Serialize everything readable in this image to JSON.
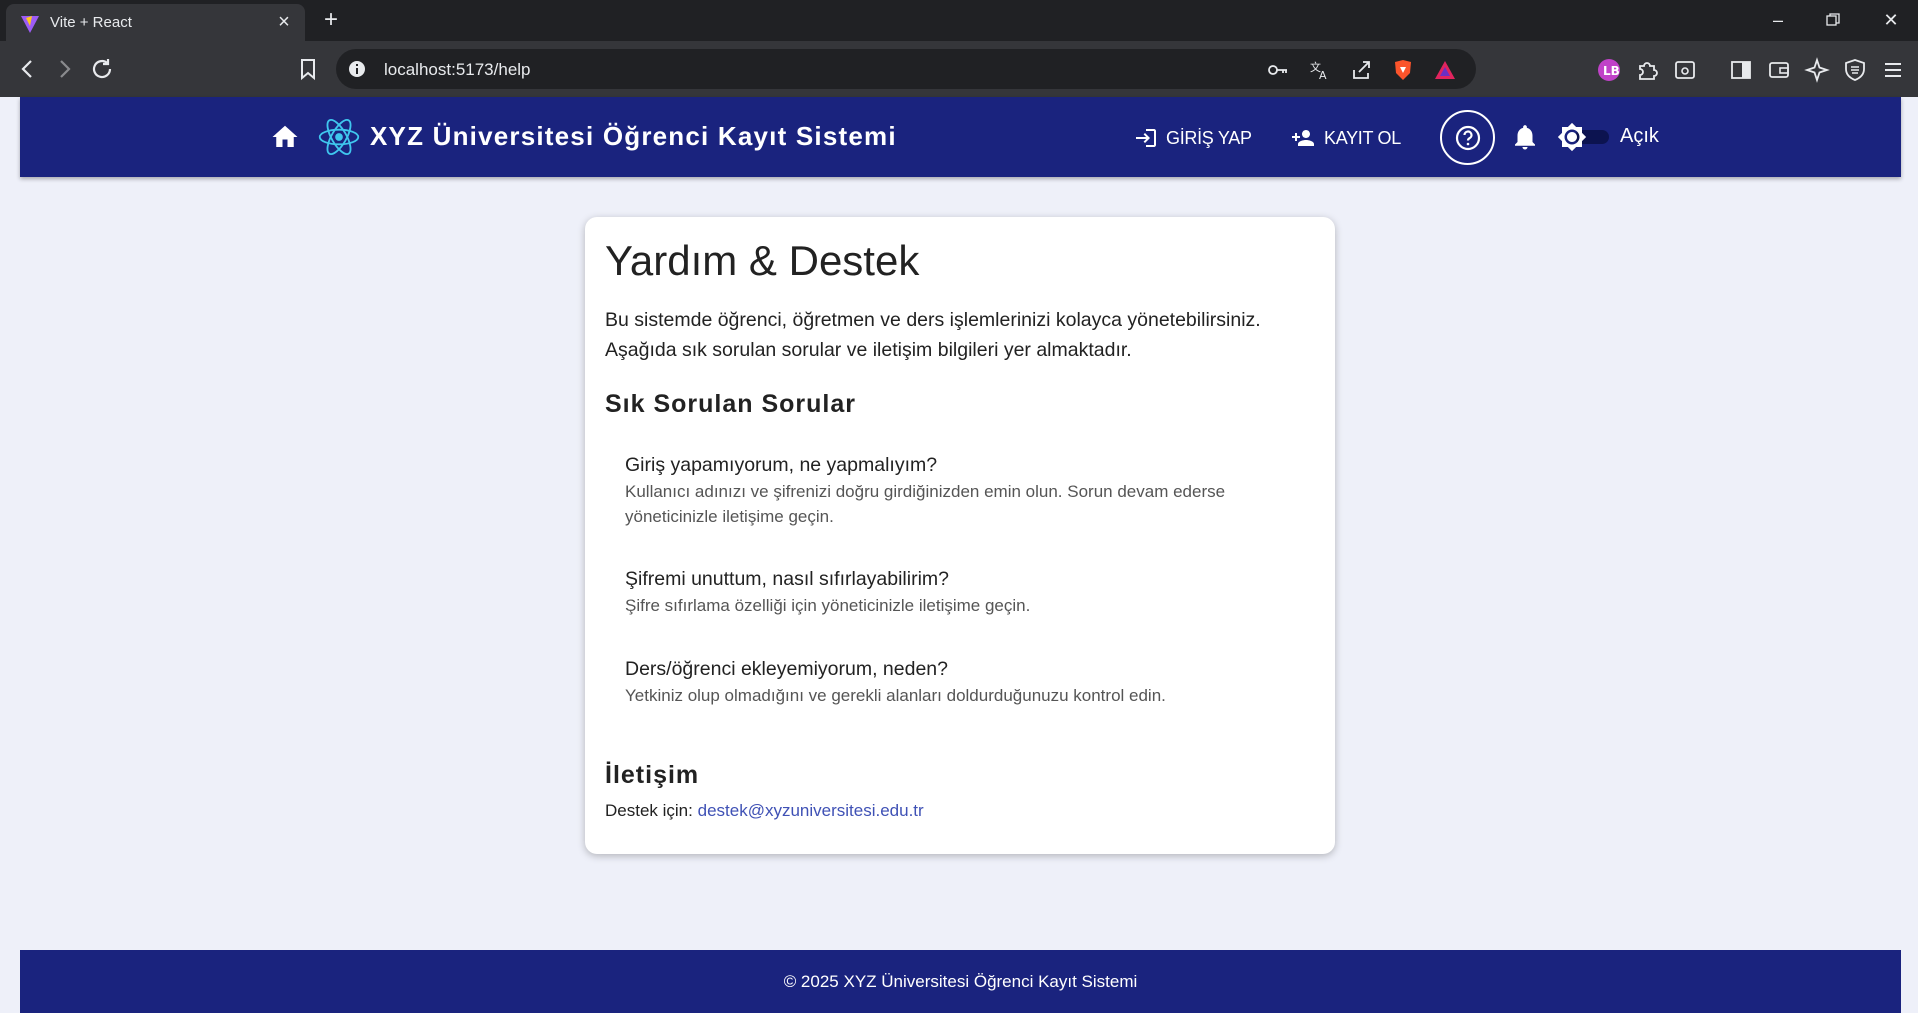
{
  "browser": {
    "tab_title": "Vite + React",
    "url": "localhost:5173/help"
  },
  "header": {
    "brand": "XYZ Üniversitesi Öğrenci Kayıt Sistemi",
    "login_label": "GİRİŞ YAP",
    "register_label": "KAYIT OL",
    "theme_label": "Açık"
  },
  "help": {
    "title": "Yardım & Destek",
    "intro": "Bu sistemde öğrenci, öğretmen ve ders işlemlerinizi kolayca yönetebilirsiniz. Aşağıda sık sorulan sorular ve iletişim bilgileri yer almaktadır.",
    "faq_heading": "Sık Sorulan Sorular",
    "faq": [
      {
        "q": "Giriş yapamıyorum, ne yapmalıyım?",
        "a": "Kullanıcı adınızı ve şifrenizi doğru girdiğinizden emin olun. Sorun devam ederse yöneticinizle iletişime geçin."
      },
      {
        "q": "Şifremi unuttum, nasıl sıfırlayabilirim?",
        "a": "Şifre sıfırlama özelliği için yöneticinizle iletişime geçin."
      },
      {
        "q": "Ders/öğrenci ekleyemiyorum, neden?",
        "a": "Yetkiniz olup olmadığını ve gerekli alanları doldurduğunuzu kontrol edin."
      }
    ],
    "contact_heading": "İletişim",
    "contact_prefix": "Destek için:",
    "contact_email": "destek@xyzuniversitesi.edu.tr"
  },
  "footer": {
    "text": "© 2025 XYZ Üniversitesi Öğrenci Kayıt Sistemi"
  },
  "colors": {
    "primary": "#1a237e",
    "link": "#3f51b5",
    "page_bg": "#eef0f9"
  }
}
